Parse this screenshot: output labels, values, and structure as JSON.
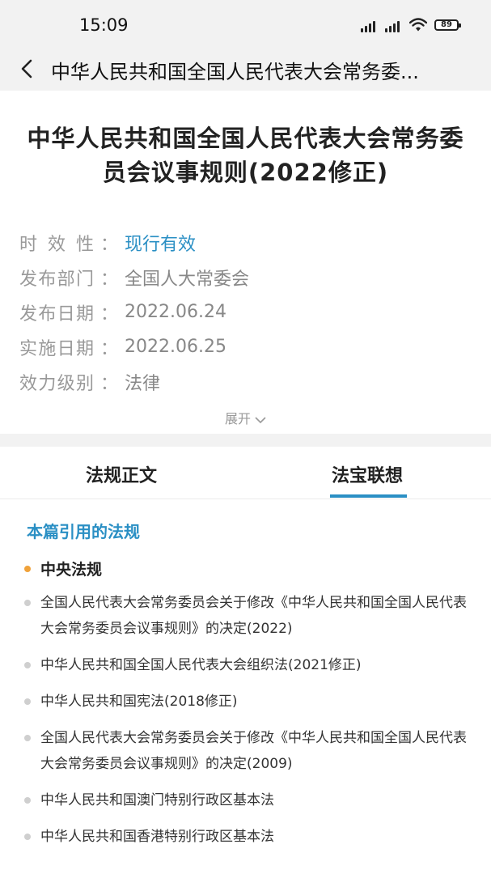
{
  "status_bar": {
    "time": "15:09",
    "battery": "89"
  },
  "nav": {
    "title": "中华人民共和国全国人民代表大会常务委..."
  },
  "document": {
    "title": "中华人民共和国全国人民代表大会常务委员会议事规则(2022修正)",
    "meta": [
      {
        "label": "时效性",
        "value": "现行有效"
      },
      {
        "label": "发布部门",
        "value": "全国人大常委会"
      },
      {
        "label": "发布日期",
        "value": "2022.06.24"
      },
      {
        "label": "实施日期",
        "value": "2022.06.25"
      },
      {
        "label": "效力级别",
        "value": "法律"
      }
    ],
    "colon": "：",
    "expand_label": "展开"
  },
  "tabs": [
    {
      "label": "法规正文",
      "active": false
    },
    {
      "label": "法宝联想",
      "active": true
    }
  ],
  "content": {
    "section_title": "本篇引用的法规",
    "group_label": "中央法规",
    "items": [
      "全国人民代表大会常务委员会关于修改《中华人民共和国全国人民代表大会常务委员会议事规则》的决定(2022)",
      "中华人民共和国全国人民代表大会组织法(2021修正)",
      "中华人民共和国宪法(2018修正)",
      "全国人民代表大会常务委员会关于修改《中华人民共和国全国人民代表大会常务委员会议事规则》的决定(2009)",
      "中华人民共和国澳门特别行政区基本法",
      "中华人民共和国香港特别行政区基本法"
    ]
  },
  "colors": {
    "accent": "#2a8fc4",
    "group_dot": "#f0a23a",
    "background": "#f2f2f2"
  }
}
